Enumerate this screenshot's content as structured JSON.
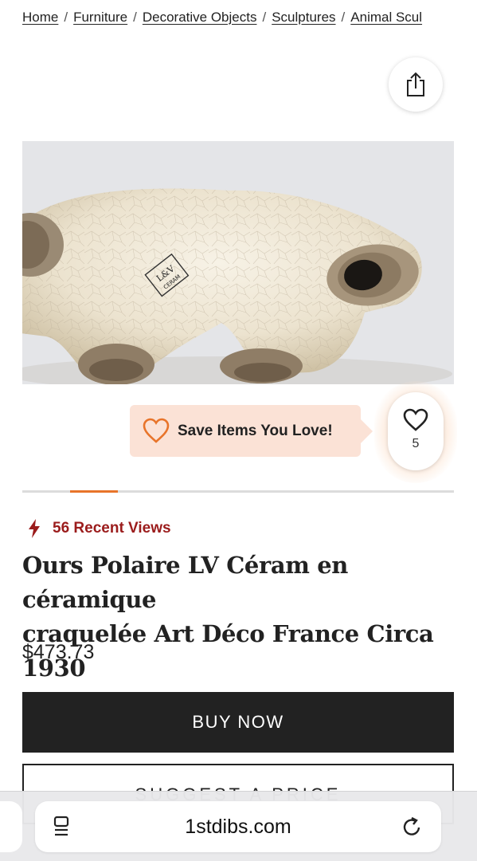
{
  "breadcrumb": {
    "items": [
      {
        "label": "Home"
      },
      {
        "label": "Furniture"
      },
      {
        "label": "Decorative Objects"
      },
      {
        "label": "Sculptures"
      },
      {
        "label": "Animal Scul"
      }
    ],
    "separator": "/"
  },
  "share": {
    "icon": "share-icon"
  },
  "product_image": {
    "alt": "white crackle-glazed ceramic polar bear",
    "maker_mark": "L&V CERAM"
  },
  "save_tooltip": {
    "text": "Save Items You Love!",
    "icon": "heart-outline-icon"
  },
  "favorite": {
    "count": "5",
    "icon": "heart-icon"
  },
  "carousel": {
    "current_fraction": 0.11
  },
  "views": {
    "text": "56 Recent Views",
    "icon": "lightning-bolt-icon"
  },
  "product": {
    "title_line1": "Ours Polaire LV Céram en céramique",
    "title_line2": "craquelée Art Déco France Circa 1930",
    "price": "$473.73"
  },
  "actions": {
    "buy_now": "BUY NOW",
    "suggest": "SUGGEST A PRICE"
  },
  "browser": {
    "url": "1stdibs.com"
  },
  "colors": {
    "accent": "#e8742a",
    "views_red": "#9b1c1c",
    "dark": "#222222",
    "tooltip_bg": "#fbe2d6"
  }
}
